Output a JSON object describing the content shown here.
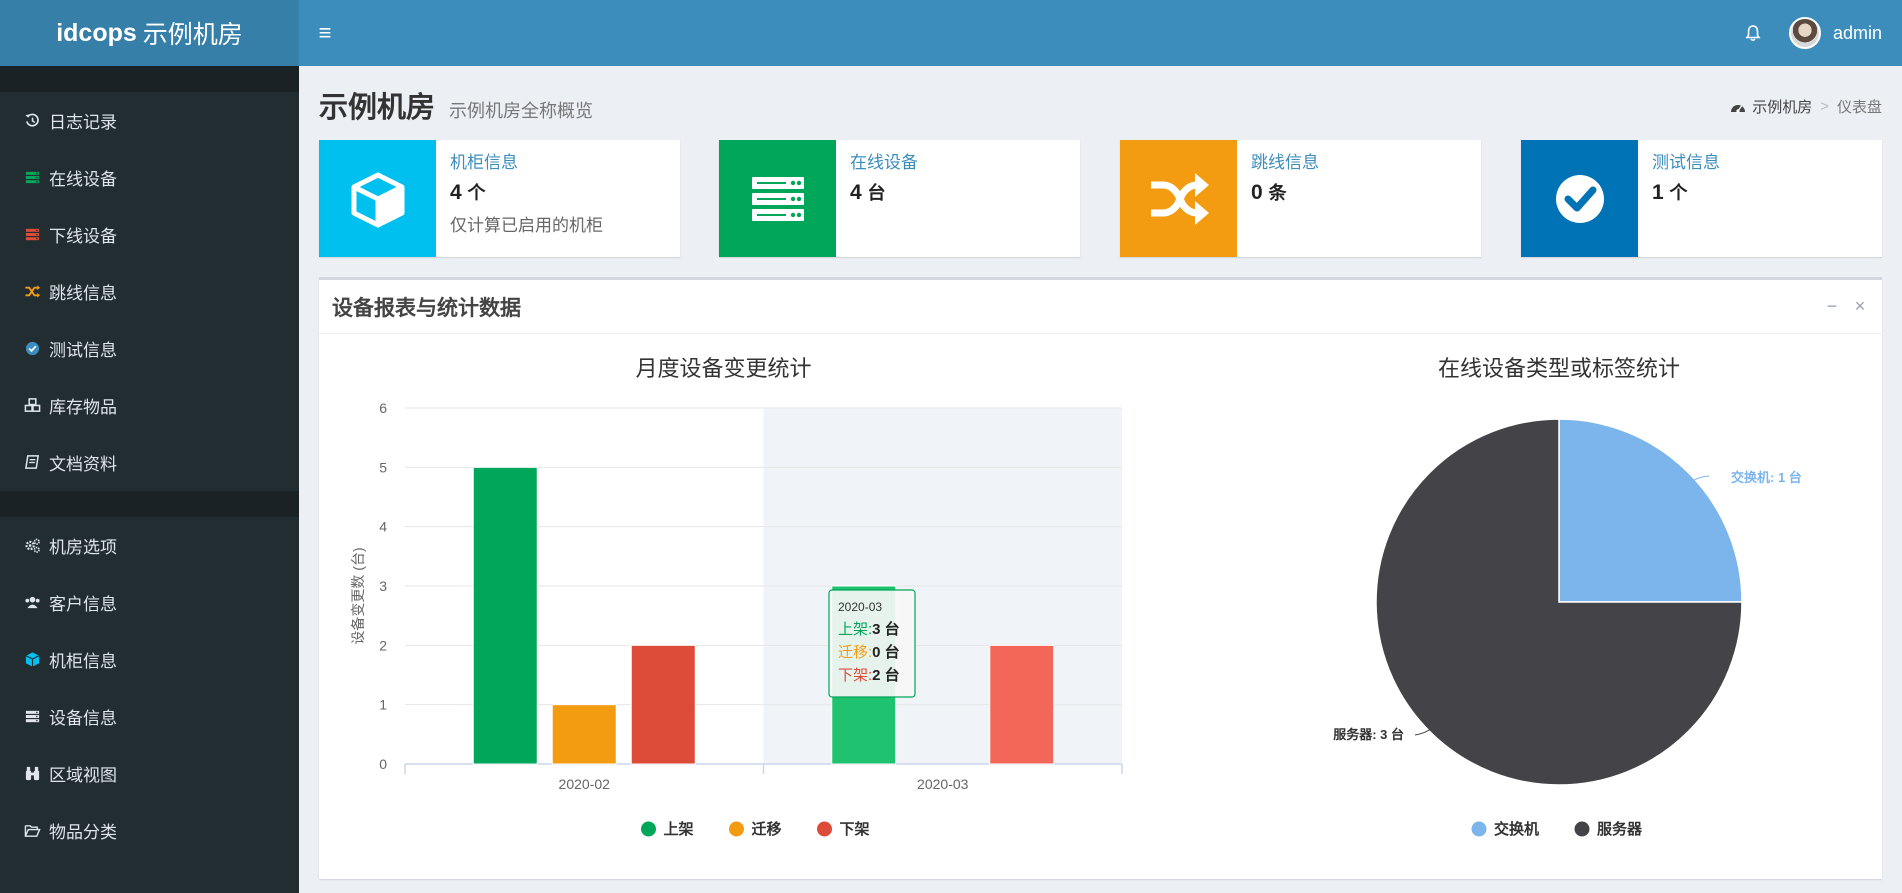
{
  "header": {
    "logo_bold": "idcops",
    "logo_rest": "示例机房",
    "menu_icon": "≡",
    "username": "admin"
  },
  "sidebar": {
    "group1": [
      {
        "label": "日志记录",
        "icon": "history-icon",
        "color": "#dfe5e8"
      },
      {
        "label": "在线设备",
        "icon": "server-icon",
        "color": "#00a65a"
      },
      {
        "label": "下线设备",
        "icon": "server-icon",
        "color": "#dd4b39"
      },
      {
        "label": "跳线信息",
        "icon": "shuffle-icon",
        "color": "#f39c12"
      },
      {
        "label": "测试信息",
        "icon": "check-circle-icon",
        "color": "#3c8dbc"
      },
      {
        "label": "库存物品",
        "icon": "cubes-icon",
        "color": "#dfe5e8"
      },
      {
        "label": "文档资料",
        "icon": "book-icon",
        "color": "#dfe5e8"
      }
    ],
    "group2": [
      {
        "label": "机房选项",
        "icon": "cogs-icon",
        "color": "#dfe5e8"
      },
      {
        "label": "客户信息",
        "icon": "users-icon",
        "color": "#dfe5e8"
      },
      {
        "label": "机柜信息",
        "icon": "cube-icon",
        "color": "#00c0ef"
      },
      {
        "label": "设备信息",
        "icon": "server-icon",
        "color": "#dfe5e8"
      },
      {
        "label": "区域视图",
        "icon": "binoculars-icon",
        "color": "#dfe5e8"
      },
      {
        "label": "物品分类",
        "icon": "folder-open-icon",
        "color": "#dfe5e8"
      }
    ]
  },
  "page": {
    "title": "示例机房",
    "subtitle": "示例机房全称概览",
    "breadcrumb_home": "示例机房",
    "breadcrumb_sep": ">",
    "breadcrumb_current": "仪表盘"
  },
  "info_boxes": [
    {
      "label": "机柜信息",
      "value": "4",
      "unit": "个",
      "desc": "仅计算已启用的机柜",
      "color": "#00c0ef",
      "icon": "cube-icon"
    },
    {
      "label": "在线设备",
      "value": "4",
      "unit": "台",
      "desc": "",
      "color": "#00a65a",
      "icon": "server-icon"
    },
    {
      "label": "跳线信息",
      "value": "0",
      "unit": "条",
      "desc": "",
      "color": "#f39c12",
      "icon": "shuffle-icon"
    },
    {
      "label": "测试信息",
      "value": "1",
      "unit": "个",
      "desc": "",
      "color": "#0073b7",
      "icon": "check-circle-icon"
    }
  ],
  "panel": {
    "title": "设备报表与统计数据",
    "minimize": "−",
    "close": "×"
  },
  "chart_data": [
    {
      "type": "bar",
      "title": "月度设备变更统计",
      "ylabel": "设备变更数 (台)",
      "xlabel": "",
      "categories": [
        "2020-02",
        "2020-03"
      ],
      "ylim": [
        0,
        6
      ],
      "yticks": [
        0,
        1,
        2,
        3,
        4,
        5,
        6
      ],
      "grid": true,
      "legend": "bottom",
      "series": [
        {
          "name": "上架",
          "values": [
            5,
            3
          ],
          "color": "#00a65a"
        },
        {
          "name": "迁移",
          "values": [
            1,
            0
          ],
          "color": "#f39c12"
        },
        {
          "name": "下架",
          "values": [
            2,
            2
          ],
          "color": "#dd4b39"
        }
      ],
      "tooltip": {
        "category": "2020-03",
        "lines": [
          {
            "name": "上架",
            "value": "3 台",
            "color": "#00a65a"
          },
          {
            "name": "迁移",
            "value": "0 台",
            "color": "#f39c12"
          },
          {
            "name": "下架",
            "value": "2 台",
            "color": "#dd4b39"
          }
        ]
      }
    },
    {
      "type": "pie",
      "title": "在线设备类型或标签统计",
      "legend": "bottom",
      "slices": [
        {
          "name": "交换机",
          "value": 1,
          "label": "交换机: 1 台",
          "color": "#7cb5ec"
        },
        {
          "name": "服务器",
          "value": 3,
          "label": "服务器: 3 台",
          "color": "#434348"
        }
      ]
    }
  ]
}
